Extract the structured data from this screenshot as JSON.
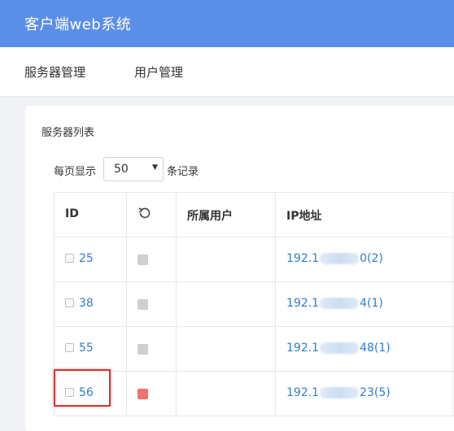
{
  "app": {
    "title": "客户端web系统"
  },
  "nav": {
    "items": [
      "服务器管理",
      "用户管理"
    ]
  },
  "card": {
    "title": "服务器列表"
  },
  "pager": {
    "prefix": "每页显示",
    "value": "50",
    "suffix": "条记录"
  },
  "table": {
    "headers": {
      "id": "ID",
      "status": "refresh-icon",
      "user": "所属用户",
      "ip": "IP地址"
    },
    "rows": [
      {
        "id": "25",
        "status_color": "#cfcfcf",
        "user": "",
        "ip_start": "192.1",
        "ip_end": "0(2)"
      },
      {
        "id": "38",
        "status_color": "#cfcfcf",
        "user": "",
        "ip_start": "192.1",
        "ip_end": "4(1)"
      },
      {
        "id": "55",
        "status_color": "#cfcfcf",
        "user": "",
        "ip_start": "192.1",
        "ip_end": "48(1)"
      },
      {
        "id": "56",
        "status_color": "#f07171",
        "user": "",
        "ip_start": "192.1",
        "ip_end": "23(5)"
      }
    ]
  },
  "colors": {
    "header_bg": "#5b8ee6",
    "link": "#2f7bd1",
    "highlight": "#e03131"
  }
}
